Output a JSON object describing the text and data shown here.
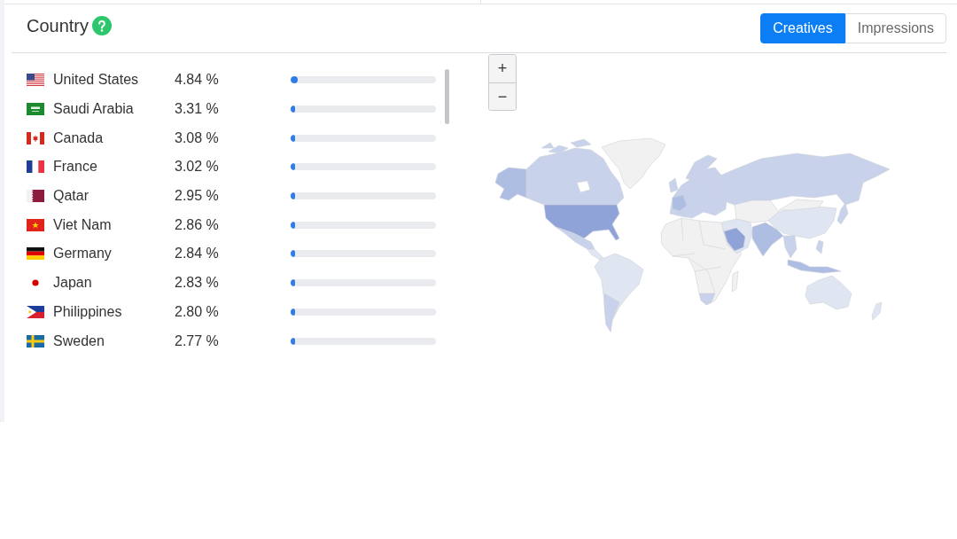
{
  "title": "Country",
  "tabs": [
    {
      "label": "Creatives",
      "selected": true
    },
    {
      "label": "Impressions",
      "selected": false
    }
  ],
  "countries": [
    {
      "kind": "us",
      "name": "United States",
      "share": "4.84 %",
      "level": 0.0484
    },
    {
      "kind": "sa",
      "name": "Saudi Arabia",
      "share": "3.31 %",
      "level": 0.0331
    },
    {
      "kind": "ca",
      "name": "Canada",
      "share": "3.08 %",
      "level": 0.0308
    },
    {
      "kind": "fr",
      "name": "France",
      "share": "3.02 %",
      "level": 0.0302
    },
    {
      "kind": "qa",
      "name": "Qatar",
      "share": "2.95 %",
      "level": 0.0295
    },
    {
      "kind": "vn",
      "name": "Viet Nam",
      "share": "2.86 %",
      "level": 0.0286
    },
    {
      "kind": "de",
      "name": "Germany",
      "share": "2.84 %",
      "level": 0.0284
    },
    {
      "kind": "jp",
      "name": "Japan",
      "share": "2.83 %",
      "level": 0.0283
    },
    {
      "kind": "ph",
      "name": "Philippines",
      "share": "2.80 %",
      "level": 0.028
    },
    {
      "kind": "se",
      "name": "Sweden",
      "share": "2.77 %",
      "level": 0.0277
    }
  ],
  "map_zoom_buttons": [
    "+",
    "−"
  ]
}
